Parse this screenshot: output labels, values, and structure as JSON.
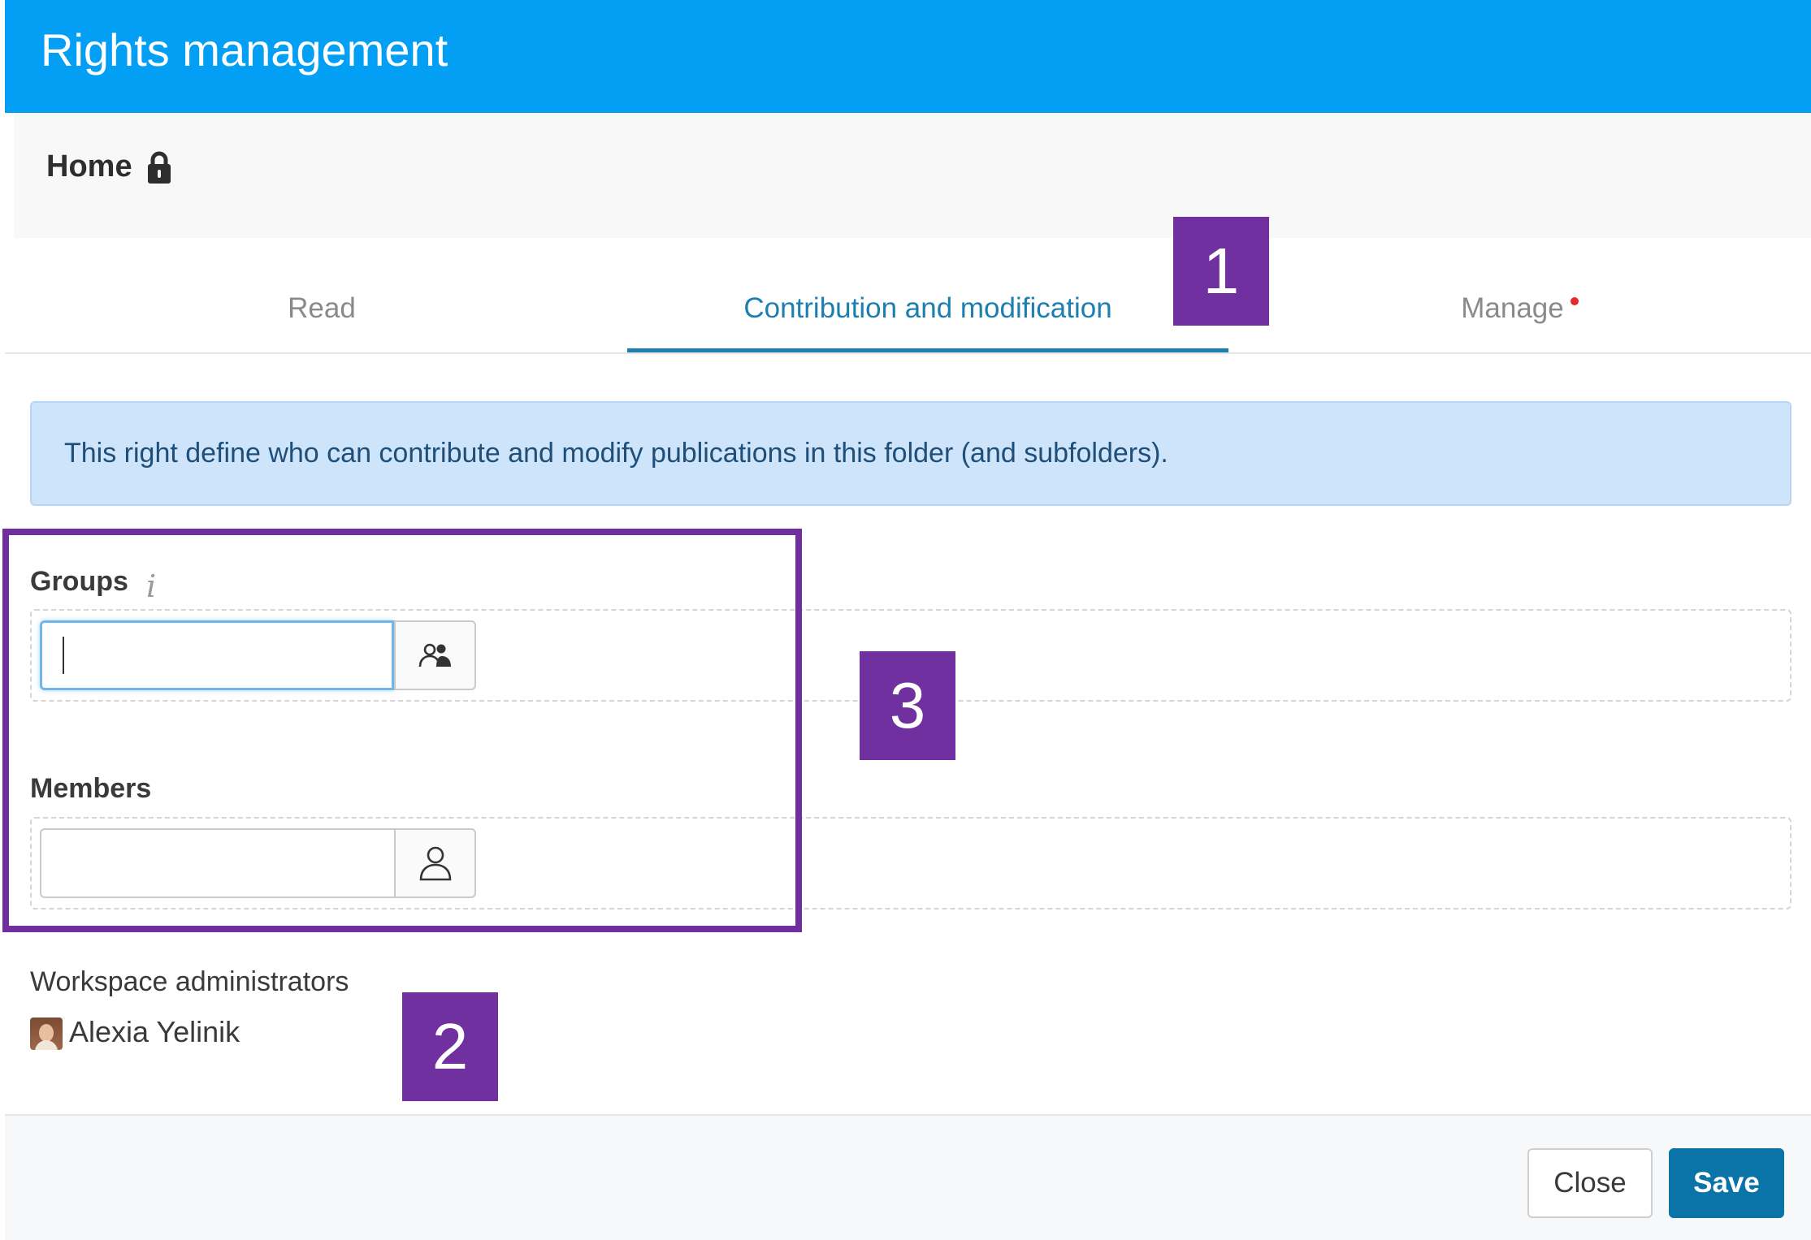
{
  "header": {
    "title": "Rights management"
  },
  "breadcrumb": {
    "home_label": "Home",
    "lock_icon": "lock-icon"
  },
  "tabs": [
    {
      "label": "Read",
      "active": false
    },
    {
      "label": "Contribution and modification",
      "active": true
    },
    {
      "label": "Manage",
      "active": false,
      "has_alert_dot": true
    }
  ],
  "info_banner": {
    "text": "This right define who can contribute and modify publications in this folder (and subfolders)."
  },
  "groups": {
    "label": "Groups",
    "info_icon": "info-icon",
    "value": "",
    "picker_icon": "group-picker-icon"
  },
  "members": {
    "label": "Members",
    "value": "",
    "picker_icon": "user-picker-icon"
  },
  "workspace_admins": {
    "label": "Workspace administrators",
    "items": [
      {
        "name": "Alexia Yelinik"
      }
    ]
  },
  "footer": {
    "close_label": "Close",
    "save_label": "Save"
  },
  "callouts": {
    "marker_1": "1",
    "marker_2": "2",
    "marker_3": "3"
  },
  "colors": {
    "header_bg": "#039ff5",
    "active_tab": "#1d7fb0",
    "banner_bg": "#cde4fb",
    "save_button": "#0a73a8",
    "callout": "#7030a0"
  }
}
